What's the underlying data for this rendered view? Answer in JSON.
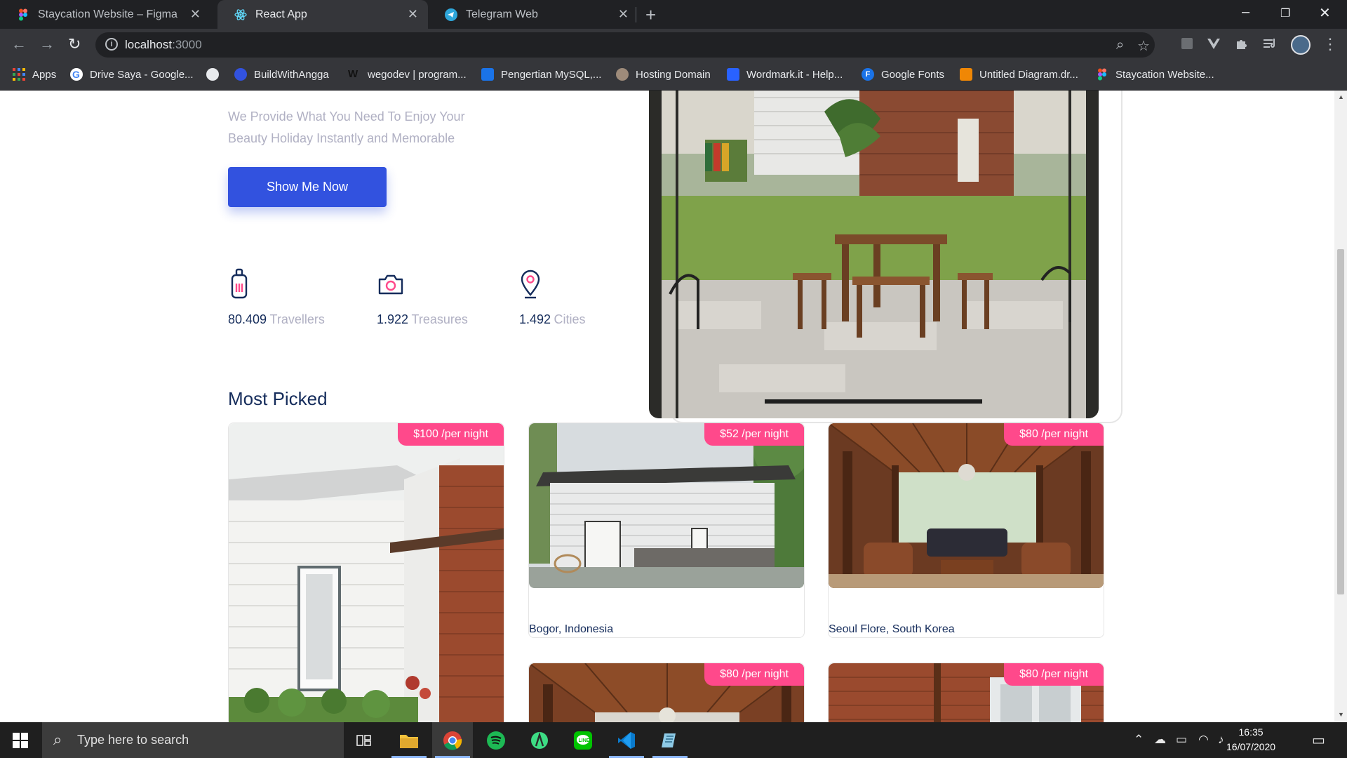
{
  "browser": {
    "tabs": [
      {
        "title": "Staycation Website – Figma",
        "icon": "figma-icon"
      },
      {
        "title": "React App",
        "icon": "react-icon",
        "active": true
      },
      {
        "title": "Telegram Web",
        "icon": "telegram-icon"
      }
    ],
    "url_host": "localhost",
    "url_port": ":3000",
    "bookmarks": [
      {
        "label": "Apps",
        "icon": "apps-grid-icon"
      },
      {
        "label": "Drive Saya - Google...",
        "icon": "google-icon"
      },
      {
        "label": "",
        "icon": "globe-icon"
      },
      {
        "label": "BuildWithAngga",
        "icon": "buildwithangga-icon"
      },
      {
        "label": "wegodev | program...",
        "icon": "wegodev-icon"
      },
      {
        "label": "Pengertian MySQL,...",
        "icon": "mysql-icon"
      },
      {
        "label": "Hosting Domain",
        "icon": "hosting-icon"
      },
      {
        "label": "Wordmark.it - Help...",
        "icon": "wordmark-icon"
      },
      {
        "label": "Google Fonts",
        "icon": "google-fonts-icon"
      },
      {
        "label": "Untitled Diagram.dr...",
        "icon": "drawio-icon"
      },
      {
        "label": "Staycation Website...",
        "icon": "figma-icon"
      }
    ]
  },
  "hero": {
    "description_line1": "We Provide What You Need To Enjoy Your",
    "description_line2": "Beauty Holiday Instantly and Memorable",
    "cta_label": "Show Me Now",
    "stats": [
      {
        "number": "80.409",
        "label": "Travellers",
        "icon": "luggage-icon"
      },
      {
        "number": "1.922",
        "label": "Treasures",
        "icon": "camera-icon"
      },
      {
        "number": "1.492",
        "label": "Cities",
        "icon": "map-pin-icon"
      }
    ]
  },
  "most_picked": {
    "title": "Most Picked",
    "items": [
      {
        "price": "$100 /per night",
        "place": ""
      },
      {
        "price": "$52 /per night",
        "place": "Bogor, Indonesia"
      },
      {
        "price": "$80 /per night",
        "place": "Seoul Flore, South Korea"
      },
      {
        "price": "$80 /per night",
        "place": ""
      },
      {
        "price": "$80 /per night",
        "place": ""
      }
    ]
  },
  "taskbar": {
    "search_placeholder": "Type here to search",
    "time": "16:35",
    "date": "16/07/2020"
  },
  "colors": {
    "primary": "#3252df",
    "accent": "#ff498b",
    "heading": "#152c5b",
    "muted": "#b0b0c3"
  }
}
